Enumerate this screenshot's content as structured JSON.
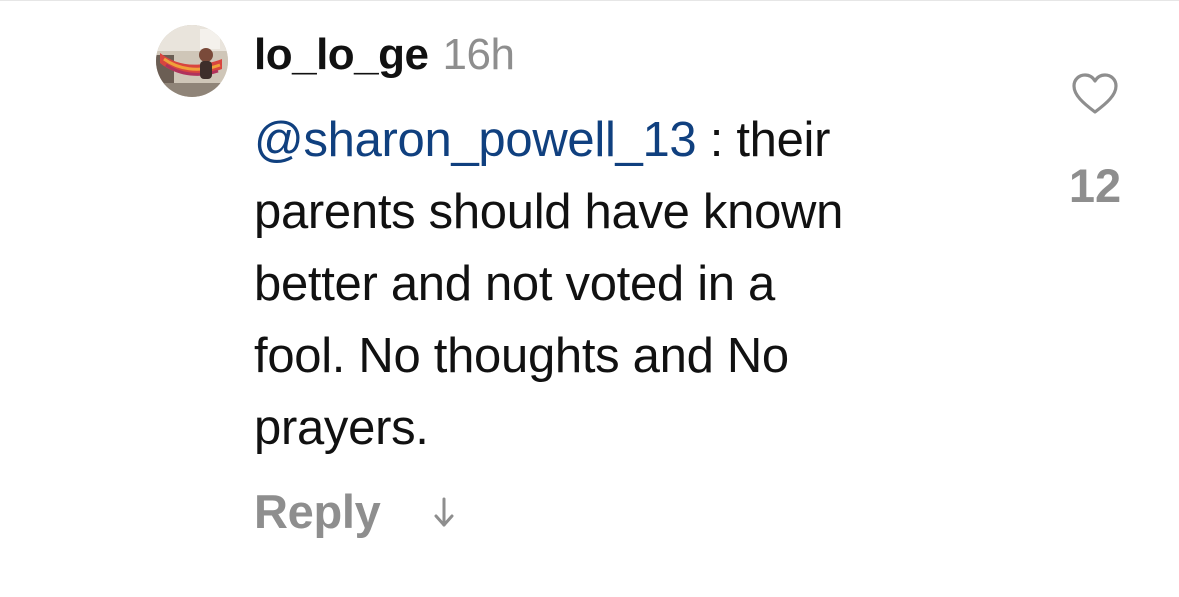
{
  "comment": {
    "username": "lo_lo_ge",
    "time": "16h",
    "mention": "@sharon_powell_13",
    "body_lines": [
      " : their",
      "parents should have known",
      "better and not voted in a",
      "fool. No thoughts and No",
      "prayers."
    ],
    "reply_label": "Reply",
    "like_count": "12"
  },
  "icons": {
    "avatar": "profile-photo",
    "like": "heart-icon",
    "expand": "arrow-down-icon"
  },
  "colors": {
    "mention": "#10407f",
    "secondary": "#8e8e8e",
    "text": "#111111"
  }
}
